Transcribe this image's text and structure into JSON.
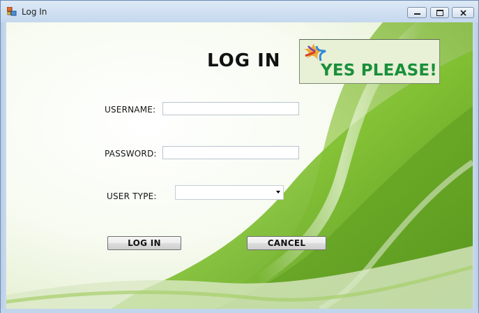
{
  "window": {
    "title": "Log In",
    "controls": {
      "minimize": "minimize-icon",
      "maximize": "maximize-icon",
      "close": "close-icon"
    }
  },
  "form": {
    "heading": "LOG IN",
    "logo_text": "YES PLEASE!",
    "username_label": "USERNAME:",
    "username_value": "",
    "password_label": "PASSWORD:",
    "password_value": "",
    "user_type_label": "USER TYPE:",
    "user_type_value": "",
    "login_button": "LOG IN",
    "cancel_button": "CANCEL"
  },
  "colors": {
    "titlebar": "#c9dbee",
    "logo_green": "#1a8f3a",
    "background_green": "#8cc63f"
  }
}
